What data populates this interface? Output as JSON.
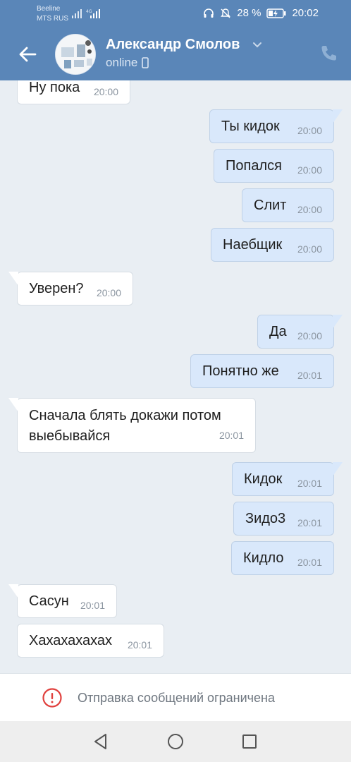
{
  "status_bar": {
    "carrier_1": "Beeline",
    "carrier_2": "MTS RUS",
    "battery": "28 %",
    "time": "20:02",
    "icons": [
      "signal-icon",
      "headphones-icon",
      "mute-icon",
      "battery-icon"
    ]
  },
  "header": {
    "contact_name": "Александр Смолов",
    "status": "online",
    "icons": [
      "back-arrow-icon",
      "chevron-down-icon",
      "phone-icon",
      "mobile-device-icon"
    ],
    "accent_color": "#5a86b8"
  },
  "messages": [
    {
      "text": "Ну пока",
      "time": "20:00",
      "direction": "in"
    },
    {
      "text": "Ты кидок",
      "time": "20:00",
      "direction": "out"
    },
    {
      "text": "Попался",
      "time": "20:00",
      "direction": "out"
    },
    {
      "text": "Слит",
      "time": "20:00",
      "direction": "out"
    },
    {
      "text": "Наебщик",
      "time": "20:00",
      "direction": "out"
    },
    {
      "text": "Уверен?",
      "time": "20:00",
      "direction": "in"
    },
    {
      "text": "Да",
      "time": "20:00",
      "direction": "out"
    },
    {
      "text": "Понятно же",
      "time": "20:01",
      "direction": "out"
    },
    {
      "text": "Сначала блять докажи потом выебывайся",
      "time": "20:01",
      "direction": "in"
    },
    {
      "text": "Кидок",
      "time": "20:01",
      "direction": "out"
    },
    {
      "text": "Зидо3",
      "time": "20:01",
      "direction": "out"
    },
    {
      "text": "Кидло",
      "time": "20:01",
      "direction": "out"
    },
    {
      "text": "Сасун",
      "time": "20:01",
      "direction": "in"
    },
    {
      "text": "Хахахахахах",
      "time": "20:01",
      "direction": "in"
    }
  ],
  "restriction": {
    "text": "Отправка сообщений ограничена",
    "icon": "warning-icon",
    "color": "#e0403d"
  },
  "navbar": {
    "icons": [
      "nav-back-icon",
      "nav-home-icon",
      "nav-recents-icon"
    ]
  }
}
